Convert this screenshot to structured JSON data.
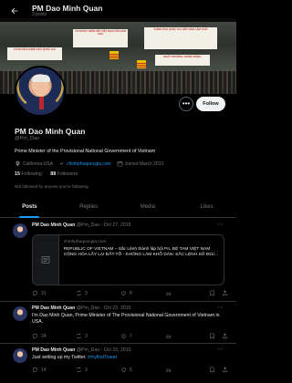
{
  "header": {
    "name": "PM Dao Minh Quan",
    "posts_count": "3 posts"
  },
  "profile": {
    "name": "PM Dao Minh Quan",
    "handle": "@Pm_Dao",
    "bio": "Prime Minister of the Provisional National Government of Vietnam",
    "location": "California-USA",
    "website": "chinhphuquocgia.com",
    "joined": "Joined March 2013",
    "following_count": "15",
    "following_label": "Following",
    "followers_count": "88",
    "followers_label": "Followers",
    "not_followed": "Not followed by anyone you're following",
    "more_label": "•••",
    "follow_label": "Follow"
  },
  "tabs": [
    "Posts",
    "Replies",
    "Media",
    "Likes"
  ],
  "posts": [
    {
      "name": "PM Dao Minh Quan",
      "meta": "@Pm_Dao · Oct 27, 2015",
      "card_domain": "chinhphuquocgia.com",
      "card_title": "REPUBLIC OF VIETNAM – Sắc Lệnh thành lập hội Pn, ĐỆ TAM VIỆT NAM CỘNG HÒA LẤY LẠI ĐẤT TỔ - KHÔNG LÀM KHỔ DÂN: SẮC LỆNH SỐ 001/...",
      "replies": "31",
      "reposts": "3",
      "likes": "8"
    },
    {
      "name": "PM Dao Minh Quan",
      "meta": "@Pm_Dao · Oct 23, 2015",
      "text": "I'm Dao Minh Quan, Prime Minister of The Provisional National Government of Vietnam in USA.",
      "replies": "24",
      "reposts": "3",
      "likes": "7"
    },
    {
      "name": "PM Dao Minh Quan",
      "meta": "@Pm_Dao · Oct 23, 2015",
      "text": "Just setting up my Twitter.",
      "hashtag": "#myfirstTweet",
      "replies": "14",
      "reposts": "3",
      "likes": "5"
    }
  ],
  "banner_signs": [
    "TƯ DƯỚC TRÊN HẾT VIỆT NAM TÂN DÂN CHỦ",
    "CHÍNH PHỦ QUỐC GIA VIỆT NAM LÂM THỜI",
    "TOÀN DÂN CHÍNH PHỦ QUỐC GIA",
    "NHẬT TRƯỜNG THÔNG ĐỘNG"
  ]
}
